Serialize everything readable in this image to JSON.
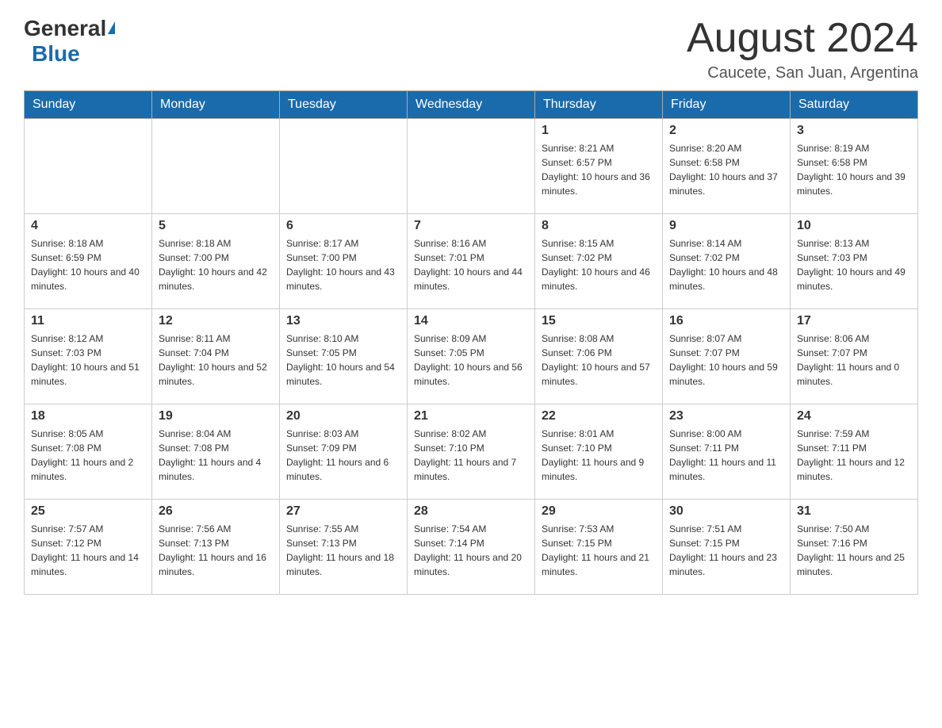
{
  "header": {
    "logo_general": "General",
    "logo_blue": "Blue",
    "month_title": "August 2024",
    "location": "Caucete, San Juan, Argentina"
  },
  "days_of_week": [
    "Sunday",
    "Monday",
    "Tuesday",
    "Wednesday",
    "Thursday",
    "Friday",
    "Saturday"
  ],
  "weeks": [
    {
      "days": [
        {
          "number": "",
          "sunrise": "",
          "sunset": "",
          "daylight": ""
        },
        {
          "number": "",
          "sunrise": "",
          "sunset": "",
          "daylight": ""
        },
        {
          "number": "",
          "sunrise": "",
          "sunset": "",
          "daylight": ""
        },
        {
          "number": "",
          "sunrise": "",
          "sunset": "",
          "daylight": ""
        },
        {
          "number": "1",
          "sunrise": "Sunrise: 8:21 AM",
          "sunset": "Sunset: 6:57 PM",
          "daylight": "Daylight: 10 hours and 36 minutes."
        },
        {
          "number": "2",
          "sunrise": "Sunrise: 8:20 AM",
          "sunset": "Sunset: 6:58 PM",
          "daylight": "Daylight: 10 hours and 37 minutes."
        },
        {
          "number": "3",
          "sunrise": "Sunrise: 8:19 AM",
          "sunset": "Sunset: 6:58 PM",
          "daylight": "Daylight: 10 hours and 39 minutes."
        }
      ]
    },
    {
      "days": [
        {
          "number": "4",
          "sunrise": "Sunrise: 8:18 AM",
          "sunset": "Sunset: 6:59 PM",
          "daylight": "Daylight: 10 hours and 40 minutes."
        },
        {
          "number": "5",
          "sunrise": "Sunrise: 8:18 AM",
          "sunset": "Sunset: 7:00 PM",
          "daylight": "Daylight: 10 hours and 42 minutes."
        },
        {
          "number": "6",
          "sunrise": "Sunrise: 8:17 AM",
          "sunset": "Sunset: 7:00 PM",
          "daylight": "Daylight: 10 hours and 43 minutes."
        },
        {
          "number": "7",
          "sunrise": "Sunrise: 8:16 AM",
          "sunset": "Sunset: 7:01 PM",
          "daylight": "Daylight: 10 hours and 44 minutes."
        },
        {
          "number": "8",
          "sunrise": "Sunrise: 8:15 AM",
          "sunset": "Sunset: 7:02 PM",
          "daylight": "Daylight: 10 hours and 46 minutes."
        },
        {
          "number": "9",
          "sunrise": "Sunrise: 8:14 AM",
          "sunset": "Sunset: 7:02 PM",
          "daylight": "Daylight: 10 hours and 48 minutes."
        },
        {
          "number": "10",
          "sunrise": "Sunrise: 8:13 AM",
          "sunset": "Sunset: 7:03 PM",
          "daylight": "Daylight: 10 hours and 49 minutes."
        }
      ]
    },
    {
      "days": [
        {
          "number": "11",
          "sunrise": "Sunrise: 8:12 AM",
          "sunset": "Sunset: 7:03 PM",
          "daylight": "Daylight: 10 hours and 51 minutes."
        },
        {
          "number": "12",
          "sunrise": "Sunrise: 8:11 AM",
          "sunset": "Sunset: 7:04 PM",
          "daylight": "Daylight: 10 hours and 52 minutes."
        },
        {
          "number": "13",
          "sunrise": "Sunrise: 8:10 AM",
          "sunset": "Sunset: 7:05 PM",
          "daylight": "Daylight: 10 hours and 54 minutes."
        },
        {
          "number": "14",
          "sunrise": "Sunrise: 8:09 AM",
          "sunset": "Sunset: 7:05 PM",
          "daylight": "Daylight: 10 hours and 56 minutes."
        },
        {
          "number": "15",
          "sunrise": "Sunrise: 8:08 AM",
          "sunset": "Sunset: 7:06 PM",
          "daylight": "Daylight: 10 hours and 57 minutes."
        },
        {
          "number": "16",
          "sunrise": "Sunrise: 8:07 AM",
          "sunset": "Sunset: 7:07 PM",
          "daylight": "Daylight: 10 hours and 59 minutes."
        },
        {
          "number": "17",
          "sunrise": "Sunrise: 8:06 AM",
          "sunset": "Sunset: 7:07 PM",
          "daylight": "Daylight: 11 hours and 0 minutes."
        }
      ]
    },
    {
      "days": [
        {
          "number": "18",
          "sunrise": "Sunrise: 8:05 AM",
          "sunset": "Sunset: 7:08 PM",
          "daylight": "Daylight: 11 hours and 2 minutes."
        },
        {
          "number": "19",
          "sunrise": "Sunrise: 8:04 AM",
          "sunset": "Sunset: 7:08 PM",
          "daylight": "Daylight: 11 hours and 4 minutes."
        },
        {
          "number": "20",
          "sunrise": "Sunrise: 8:03 AM",
          "sunset": "Sunset: 7:09 PM",
          "daylight": "Daylight: 11 hours and 6 minutes."
        },
        {
          "number": "21",
          "sunrise": "Sunrise: 8:02 AM",
          "sunset": "Sunset: 7:10 PM",
          "daylight": "Daylight: 11 hours and 7 minutes."
        },
        {
          "number": "22",
          "sunrise": "Sunrise: 8:01 AM",
          "sunset": "Sunset: 7:10 PM",
          "daylight": "Daylight: 11 hours and 9 minutes."
        },
        {
          "number": "23",
          "sunrise": "Sunrise: 8:00 AM",
          "sunset": "Sunset: 7:11 PM",
          "daylight": "Daylight: 11 hours and 11 minutes."
        },
        {
          "number": "24",
          "sunrise": "Sunrise: 7:59 AM",
          "sunset": "Sunset: 7:11 PM",
          "daylight": "Daylight: 11 hours and 12 minutes."
        }
      ]
    },
    {
      "days": [
        {
          "number": "25",
          "sunrise": "Sunrise: 7:57 AM",
          "sunset": "Sunset: 7:12 PM",
          "daylight": "Daylight: 11 hours and 14 minutes."
        },
        {
          "number": "26",
          "sunrise": "Sunrise: 7:56 AM",
          "sunset": "Sunset: 7:13 PM",
          "daylight": "Daylight: 11 hours and 16 minutes."
        },
        {
          "number": "27",
          "sunrise": "Sunrise: 7:55 AM",
          "sunset": "Sunset: 7:13 PM",
          "daylight": "Daylight: 11 hours and 18 minutes."
        },
        {
          "number": "28",
          "sunrise": "Sunrise: 7:54 AM",
          "sunset": "Sunset: 7:14 PM",
          "daylight": "Daylight: 11 hours and 20 minutes."
        },
        {
          "number": "29",
          "sunrise": "Sunrise: 7:53 AM",
          "sunset": "Sunset: 7:15 PM",
          "daylight": "Daylight: 11 hours and 21 minutes."
        },
        {
          "number": "30",
          "sunrise": "Sunrise: 7:51 AM",
          "sunset": "Sunset: 7:15 PM",
          "daylight": "Daylight: 11 hours and 23 minutes."
        },
        {
          "number": "31",
          "sunrise": "Sunrise: 7:50 AM",
          "sunset": "Sunset: 7:16 PM",
          "daylight": "Daylight: 11 hours and 25 minutes."
        }
      ]
    }
  ]
}
